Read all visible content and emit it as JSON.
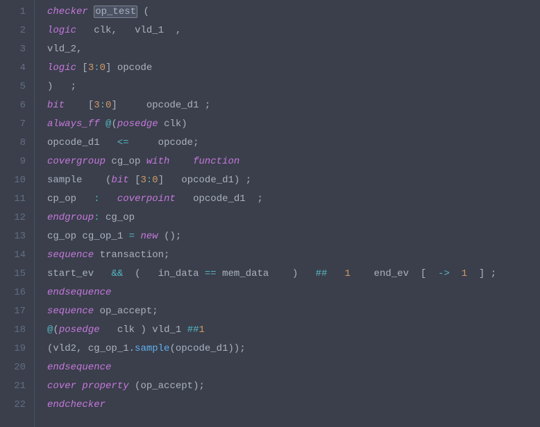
{
  "lines": [
    {
      "n": "1",
      "tokens": [
        [
          "kw",
          "checker"
        ],
        [
          "sp",
          " "
        ],
        [
          "selid",
          "op_test"
        ],
        [
          "sp",
          " "
        ],
        [
          "punc",
          "("
        ]
      ]
    },
    {
      "n": "2",
      "tokens": [
        [
          "type",
          "logic"
        ],
        [
          "sp",
          "   "
        ],
        [
          "id",
          "clk"
        ],
        [
          "punc",
          ","
        ],
        [
          "sp",
          "   "
        ],
        [
          "id",
          "vld_1"
        ],
        [
          "sp",
          "  "
        ],
        [
          "punc",
          ","
        ]
      ]
    },
    {
      "n": "3",
      "tokens": [
        [
          "id",
          "vld_2"
        ],
        [
          "punc",
          ","
        ]
      ]
    },
    {
      "n": "4",
      "tokens": [
        [
          "type",
          "logic"
        ],
        [
          "sp",
          " "
        ],
        [
          "punc",
          "["
        ],
        [
          "num",
          "3"
        ],
        [
          "op",
          ":"
        ],
        [
          "num",
          "0"
        ],
        [
          "punc",
          "]"
        ],
        [
          "sp",
          " "
        ],
        [
          "id",
          "opcode"
        ]
      ]
    },
    {
      "n": "5",
      "tokens": [
        [
          "punc",
          ")"
        ],
        [
          "sp",
          "   "
        ],
        [
          "punc",
          ";"
        ]
      ]
    },
    {
      "n": "6",
      "tokens": [
        [
          "type",
          "bit"
        ],
        [
          "sp",
          "    "
        ],
        [
          "punc",
          "["
        ],
        [
          "num",
          "3"
        ],
        [
          "op",
          ":"
        ],
        [
          "num",
          "0"
        ],
        [
          "punc",
          "]"
        ],
        [
          "sp",
          "     "
        ],
        [
          "id",
          "opcode_d1"
        ],
        [
          "sp",
          " "
        ],
        [
          "punc",
          ";"
        ]
      ]
    },
    {
      "n": "7",
      "tokens": [
        [
          "kw",
          "always_ff"
        ],
        [
          "sp",
          " "
        ],
        [
          "op",
          "@"
        ],
        [
          "punc",
          "("
        ],
        [
          "kw",
          "posedge"
        ],
        [
          "sp",
          " "
        ],
        [
          "id",
          "clk"
        ],
        [
          "punc",
          ")"
        ]
      ]
    },
    {
      "n": "8",
      "tokens": [
        [
          "id",
          "opcode_d1"
        ],
        [
          "sp",
          "   "
        ],
        [
          "op",
          "<="
        ],
        [
          "sp",
          "     "
        ],
        [
          "id",
          "opcode"
        ],
        [
          "punc",
          ";"
        ]
      ]
    },
    {
      "n": "9",
      "tokens": [
        [
          "kw",
          "covergroup"
        ],
        [
          "sp",
          " "
        ],
        [
          "id",
          "cg_op"
        ],
        [
          "sp",
          " "
        ],
        [
          "kw",
          "with"
        ],
        [
          "sp",
          "    "
        ],
        [
          "kw",
          "function"
        ]
      ]
    },
    {
      "n": "10",
      "tokens": [
        [
          "id",
          "sample"
        ],
        [
          "sp",
          "    "
        ],
        [
          "punc",
          "("
        ],
        [
          "type",
          "bit"
        ],
        [
          "sp",
          " "
        ],
        [
          "punc",
          "["
        ],
        [
          "num",
          "3"
        ],
        [
          "op",
          ":"
        ],
        [
          "num",
          "0"
        ],
        [
          "punc",
          "]"
        ],
        [
          "sp",
          "   "
        ],
        [
          "id",
          "opcode_d1"
        ],
        [
          "punc",
          ")"
        ],
        [
          "sp",
          " "
        ],
        [
          "punc",
          ";"
        ]
      ]
    },
    {
      "n": "11",
      "tokens": [
        [
          "id",
          "cp_op"
        ],
        [
          "sp",
          "   "
        ],
        [
          "op",
          ":"
        ],
        [
          "sp",
          "   "
        ],
        [
          "kw",
          "coverpoint"
        ],
        [
          "sp",
          "   "
        ],
        [
          "id",
          "opcode_d1"
        ],
        [
          "sp",
          "  "
        ],
        [
          "punc",
          ";"
        ]
      ]
    },
    {
      "n": "12",
      "tokens": [
        [
          "kw",
          "endgroup"
        ],
        [
          "op",
          ":"
        ],
        [
          "sp",
          " "
        ],
        [
          "id",
          "cg_op"
        ]
      ]
    },
    {
      "n": "13",
      "tokens": [
        [
          "id",
          "cg_op"
        ],
        [
          "sp",
          " "
        ],
        [
          "id",
          "cg_op_1"
        ],
        [
          "sp",
          " "
        ],
        [
          "op",
          "="
        ],
        [
          "sp",
          " "
        ],
        [
          "kw",
          "new"
        ],
        [
          "sp",
          " "
        ],
        [
          "punc",
          "("
        ],
        [
          "punc",
          ")"
        ],
        [
          "punc",
          ";"
        ]
      ]
    },
    {
      "n": "14",
      "tokens": [
        [
          "kw",
          "sequence"
        ],
        [
          "sp",
          " "
        ],
        [
          "id",
          "transaction"
        ],
        [
          "punc",
          ";"
        ]
      ]
    },
    {
      "n": "15",
      "tokens": [
        [
          "id",
          "start_ev"
        ],
        [
          "sp",
          "   "
        ],
        [
          "op",
          "&&"
        ],
        [
          "sp",
          "  "
        ],
        [
          "punc",
          "("
        ],
        [
          "sp",
          "   "
        ],
        [
          "id",
          "in_data"
        ],
        [
          "sp",
          " "
        ],
        [
          "op",
          "=="
        ],
        [
          "sp",
          " "
        ],
        [
          "id",
          "mem_data"
        ],
        [
          "sp",
          "    "
        ],
        [
          "punc",
          ")"
        ],
        [
          "sp",
          "   "
        ],
        [
          "op",
          "##"
        ],
        [
          "sp",
          "   "
        ],
        [
          "num",
          "1"
        ],
        [
          "sp",
          "    "
        ],
        [
          "id",
          "end_ev"
        ],
        [
          "sp",
          "  "
        ],
        [
          "punc",
          "["
        ],
        [
          "sp",
          "  "
        ],
        [
          "op",
          "->"
        ],
        [
          "sp",
          "  "
        ],
        [
          "num",
          "1"
        ],
        [
          "sp",
          "  "
        ],
        [
          "punc",
          "]"
        ],
        [
          "sp",
          " "
        ],
        [
          "punc",
          ";"
        ]
      ]
    },
    {
      "n": "16",
      "tokens": [
        [
          "kw",
          "endsequence"
        ]
      ]
    },
    {
      "n": "17",
      "tokens": [
        [
          "kw",
          "sequence"
        ],
        [
          "sp",
          " "
        ],
        [
          "id",
          "op_accept"
        ],
        [
          "punc",
          ";"
        ]
      ]
    },
    {
      "n": "18",
      "tokens": [
        [
          "op",
          "@"
        ],
        [
          "punc",
          "("
        ],
        [
          "kw",
          "posedge"
        ],
        [
          "sp",
          "   "
        ],
        [
          "id",
          "clk"
        ],
        [
          "sp",
          " "
        ],
        [
          "punc",
          ")"
        ],
        [
          "sp",
          " "
        ],
        [
          "id",
          "vld_1"
        ],
        [
          "sp",
          " "
        ],
        [
          "op",
          "##"
        ],
        [
          "num",
          "1"
        ]
      ]
    },
    {
      "n": "19",
      "tokens": [
        [
          "punc",
          "("
        ],
        [
          "id",
          "vld2"
        ],
        [
          "punc",
          ","
        ],
        [
          "sp",
          " "
        ],
        [
          "id",
          "cg_op_1"
        ],
        [
          "punc",
          "."
        ],
        [
          "fn",
          "sample"
        ],
        [
          "punc",
          "("
        ],
        [
          "id",
          "opcode_d1"
        ],
        [
          "punc",
          ")"
        ],
        [
          "punc",
          ")"
        ],
        [
          "punc",
          ";"
        ]
      ]
    },
    {
      "n": "20",
      "tokens": [
        [
          "kw",
          "endsequence"
        ]
      ]
    },
    {
      "n": "21",
      "tokens": [
        [
          "kw",
          "cover"
        ],
        [
          "sp",
          " "
        ],
        [
          "kw",
          "property"
        ],
        [
          "sp",
          " "
        ],
        [
          "punc",
          "("
        ],
        [
          "id",
          "op_accept"
        ],
        [
          "punc",
          ")"
        ],
        [
          "punc",
          ";"
        ]
      ]
    },
    {
      "n": "22",
      "tokens": [
        [
          "kw",
          "endchecker"
        ]
      ]
    }
  ]
}
